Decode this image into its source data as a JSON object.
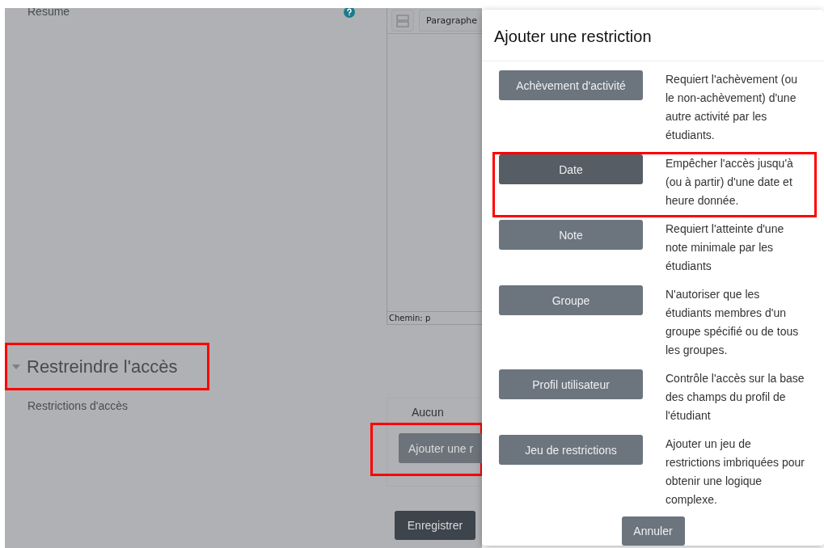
{
  "page": {
    "summary_label": "Resume",
    "editor": {
      "format_dropdown": "Paragraphe",
      "path": "Chemin: p"
    },
    "section": {
      "title": "Restreindre l'accès",
      "expanded": true,
      "highlighted": true
    },
    "restrictions_label": "Restrictions d'accès",
    "restrictions_value": "Aucun",
    "add_button": {
      "label": "Ajouter une r",
      "highlighted": true
    },
    "save_button": "Enregistrer"
  },
  "dialog": {
    "title": "Ajouter une restriction",
    "options": [
      {
        "label": "Achèvement d'activité",
        "description": "Requiert l'achèvement (ou le non-achèvement) d'une autre activité par les étudiants.",
        "highlighted": false
      },
      {
        "label": "Date",
        "description": "Empêcher l'accès jusqu'à (ou à partir) d'une date et heure donnée.",
        "highlighted": true
      },
      {
        "label": "Note",
        "description": "Requiert l'atteinte d'une note minimale par les étudiants",
        "highlighted": false
      },
      {
        "label": "Groupe",
        "description": "N'autoriser que les étudiants membres d'un groupe spécifié ou de tous les groupes.",
        "highlighted": false
      },
      {
        "label": "Profil utilisateur",
        "description": "Contrôle l'accès sur la base des champs du profil de l'étudiant",
        "highlighted": false
      },
      {
        "label": "Jeu de restrictions",
        "description": "Ajouter un jeu de restrictions imbriquées pour obtenir une logique complexe.",
        "highlighted": false
      }
    ],
    "cancel_button": "Annuler"
  }
}
